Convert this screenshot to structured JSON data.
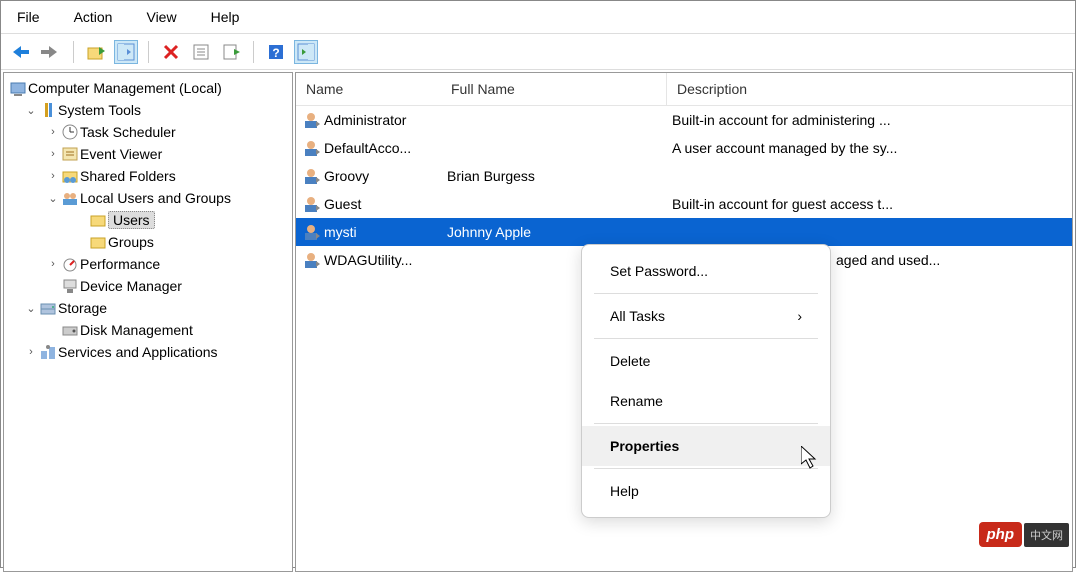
{
  "menubar": [
    "File",
    "Action",
    "View",
    "Help"
  ],
  "tree": {
    "root": "Computer Management (Local)",
    "items": [
      {
        "label": "System Tools",
        "indent": 1,
        "expanded": true,
        "icon": "tools"
      },
      {
        "label": "Task Scheduler",
        "indent": 2,
        "icon": "clock",
        "has_children": true
      },
      {
        "label": "Event Viewer",
        "indent": 2,
        "icon": "event",
        "has_children": true
      },
      {
        "label": "Shared Folders",
        "indent": 2,
        "icon": "shared",
        "has_children": true
      },
      {
        "label": "Local Users and Groups",
        "indent": 2,
        "icon": "users",
        "expanded": true,
        "has_children": true
      },
      {
        "label": "Users",
        "indent": 3,
        "icon": "folder",
        "selected": true
      },
      {
        "label": "Groups",
        "indent": 3,
        "icon": "folder"
      },
      {
        "label": "Performance",
        "indent": 2,
        "icon": "perf",
        "has_children": true
      },
      {
        "label": "Device Manager",
        "indent": 2,
        "icon": "device"
      },
      {
        "label": "Storage",
        "indent": 1,
        "expanded": true,
        "icon": "storage"
      },
      {
        "label": "Disk Management",
        "indent": 2,
        "icon": "disk"
      },
      {
        "label": "Services and Applications",
        "indent": 1,
        "icon": "services",
        "has_children": true
      }
    ]
  },
  "columns": {
    "name": "Name",
    "fullname": "Full Name",
    "desc": "Description"
  },
  "users": [
    {
      "name": "Administrator",
      "fullname": "",
      "desc": "Built-in account for administering ..."
    },
    {
      "name": "DefaultAcco...",
      "fullname": "",
      "desc": "A user account managed by the sy..."
    },
    {
      "name": "Groovy",
      "fullname": "Brian Burgess",
      "desc": ""
    },
    {
      "name": "Guest",
      "fullname": "",
      "desc": "Built-in account for guest access t..."
    },
    {
      "name": "mysti",
      "fullname": "Johnny Apple",
      "desc": "",
      "selected": true
    },
    {
      "name": "WDAGUtility...",
      "fullname": "",
      "desc": "aged and used...",
      "desc_offset": true
    }
  ],
  "context_menu": {
    "items": [
      {
        "label": "Set Password..."
      },
      {
        "sep": true
      },
      {
        "label": "All Tasks",
        "submenu": true
      },
      {
        "sep": true
      },
      {
        "label": "Delete"
      },
      {
        "label": "Rename"
      },
      {
        "sep": true
      },
      {
        "label": "Properties",
        "hover": true
      },
      {
        "sep": true
      },
      {
        "label": "Help"
      }
    ]
  },
  "watermark": {
    "badge": "php",
    "text": "中文网"
  }
}
